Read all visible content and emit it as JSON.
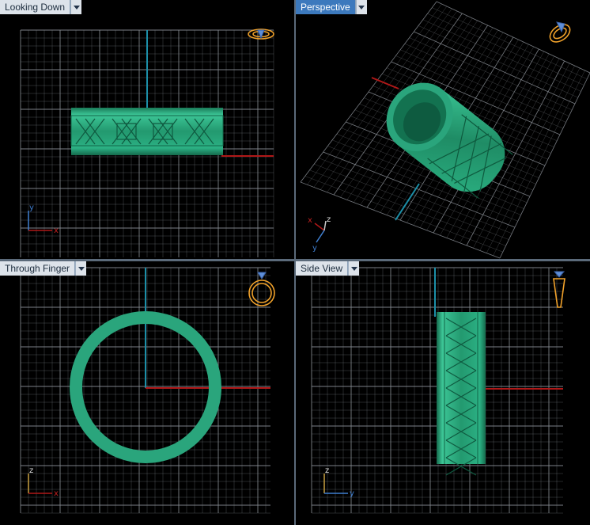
{
  "viewports": {
    "top_left": {
      "label": "Looking Down",
      "active": false
    },
    "top_right": {
      "label": "Perspective",
      "active": true
    },
    "bottom_left": {
      "label": "Through Finger",
      "active": false
    },
    "bottom_right": {
      "label": "Side View",
      "active": false
    }
  },
  "axes": {
    "looking_down": {
      "a": "y",
      "b": "x"
    },
    "perspective": {
      "a": "x",
      "b": "z",
      "c": "y"
    },
    "through_finger": {
      "a": "z",
      "b": "x"
    },
    "side_view": {
      "a": "z",
      "b": "y"
    }
  },
  "colors": {
    "model": "#2aa57c",
    "model_dark": "#177552",
    "grid": "#8a8f96",
    "axis_red": "#b01818",
    "axis_cyan": "#1c8fa8",
    "nav_icon": "#f0a12a",
    "active_tab": "#3c79bd"
  },
  "icons": {
    "view_cube": "ring-orientation-icon",
    "dropdown": "chevron-down-icon"
  }
}
